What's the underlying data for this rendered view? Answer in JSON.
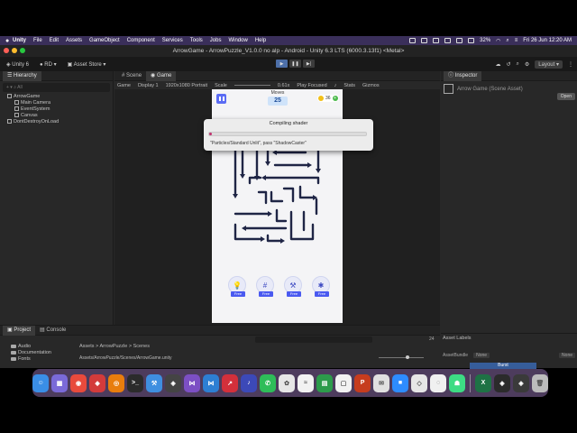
{
  "menubar": {
    "app": "Unity",
    "items": [
      "File",
      "Edit",
      "Assets",
      "GameObject",
      "Component",
      "Services",
      "Tools",
      "Jobs",
      "Window",
      "Help"
    ],
    "battery": "32%",
    "datetime": "Fri 26 Jun  12:20 AM"
  },
  "window": {
    "title": "ArrowGame - ArrowPuzzle_V1.0.0 no alp - Android - Unity 6.3 LTS (6000.3.13f1) <Metal>"
  },
  "toolbar": {
    "unity_version": "Unity 6",
    "account": "RD",
    "asset_store": "Asset Store",
    "layout": "Layout"
  },
  "hierarchy": {
    "tab": "Hierarchy",
    "search_placeholder": "All",
    "items": [
      {
        "label": "ArrowGame",
        "indent": 1
      },
      {
        "label": "Main Camera",
        "indent": 2
      },
      {
        "label": "EventSystem",
        "indent": 2
      },
      {
        "label": "Canvas",
        "indent": 2
      },
      {
        "label": "DontDestroyOnLoad",
        "indent": 1
      }
    ]
  },
  "views": {
    "scene_tab": "Scene",
    "game_tab": "Game",
    "mode": "Game",
    "display": "Display 1",
    "resolution": "1920x1080 Portrait",
    "scale_label": "Scale",
    "scale_value": "0.61x",
    "play_focused": "Play Focused",
    "stats": "Stats",
    "gizmos": "Gizmos"
  },
  "game": {
    "moves_label": "Moves",
    "moves_value": "25",
    "coins": "36",
    "plus": "+",
    "powerups": [
      {
        "icon": "lightbulb-icon",
        "glyph": "💡",
        "label": "Free"
      },
      {
        "icon": "grid-icon",
        "glyph": "#",
        "label": "Free"
      },
      {
        "icon": "hammer-icon",
        "glyph": "⚒",
        "label": "Free"
      },
      {
        "icon": "sparkle-icon",
        "glyph": "✱",
        "label": "Free"
      }
    ]
  },
  "dialog": {
    "title": "Compiling shader",
    "progress": 0.02,
    "message": "\"Particles/Standard Unlit\", pass \"ShadowCaster\""
  },
  "inspector": {
    "tab": "Inspector",
    "asset_title": "Arrow Game (Scene Asset)",
    "open_button": "Open",
    "asset_labels": "Asset Labels",
    "asset_bundle_label": "AssetBundle",
    "bundle_value": "None",
    "variant_value": "None",
    "burst": "Burst"
  },
  "project": {
    "project_tab": "Project",
    "console_tab": "Console",
    "folders": [
      "Audio",
      "Documentation",
      "Fonts"
    ],
    "breadcrumb": "Assets > ArrowPuzzle > Scenes",
    "path": "Assets/ArrowPuzzle/Scenes/ArrowGame.unity",
    "count": "24"
  },
  "dock": {
    "apps": [
      {
        "icon": "finder-icon",
        "color": "#3a8ee6",
        "glyph": "☺"
      },
      {
        "icon": "launchpad-icon",
        "color": "#7a6ad8",
        "glyph": "▦"
      },
      {
        "icon": "chrome-icon",
        "color": "#e84a3c",
        "glyph": "◉"
      },
      {
        "icon": "anydesk-icon",
        "color": "#d33b3b",
        "glyph": "◆"
      },
      {
        "icon": "blender-icon",
        "color": "#e87d0d",
        "glyph": "◎"
      },
      {
        "icon": "terminal-icon",
        "color": "#2b2b2b",
        "glyph": ">_"
      },
      {
        "icon": "xcode-icon",
        "color": "#3f8fe0",
        "glyph": "⚒"
      },
      {
        "icon": "unity-hub-icon",
        "color": "#444444",
        "glyph": "◈"
      },
      {
        "icon": "visual-studio-icon",
        "color": "#7c4fc4",
        "glyph": "⋈"
      },
      {
        "icon": "vscode-icon",
        "color": "#2d7fd3",
        "glyph": "⋈"
      },
      {
        "icon": "cursor-app-icon",
        "color": "#d3303b",
        "glyph": "↗"
      },
      {
        "icon": "mp3-icon",
        "color": "#3c49b8",
        "glyph": "♪"
      },
      {
        "icon": "whatsapp-icon",
        "color": "#2ebd59",
        "glyph": "✆"
      },
      {
        "icon": "photos-icon",
        "color": "#e6e6e6",
        "glyph": "✿"
      },
      {
        "icon": "chart-app-icon",
        "color": "#f2f2f2",
        "glyph": "≈"
      },
      {
        "icon": "sheets-icon",
        "color": "#2c9b4b",
        "glyph": "▤"
      },
      {
        "icon": "notes-app-icon",
        "color": "#f2f2f2",
        "glyph": "▢"
      },
      {
        "icon": "powerpoint-icon",
        "color": "#c63c1e",
        "glyph": "P"
      },
      {
        "icon": "messages-icon",
        "color": "#e0e0e0",
        "glyph": "✉"
      },
      {
        "icon": "zoom-icon",
        "color": "#2d8cff",
        "glyph": "■"
      },
      {
        "icon": "roblox-icon",
        "color": "#e6e6e6",
        "glyph": "◇"
      },
      {
        "icon": "photo-booth-icon",
        "color": "#f0f0f0",
        "glyph": "◌"
      },
      {
        "icon": "android-icon",
        "color": "#3ddc84",
        "glyph": "☗"
      },
      {
        "icon": "excel-icon",
        "color": "#1e7245",
        "glyph": "X"
      },
      {
        "icon": "unity-icon",
        "color": "#2b2b2b",
        "glyph": "◈"
      },
      {
        "icon": "unity-editor-icon",
        "color": "#3a3a3a",
        "glyph": "◈"
      },
      {
        "icon": "trash-icon",
        "color": "#bcbcbc",
        "glyph": "🗑"
      }
    ]
  }
}
